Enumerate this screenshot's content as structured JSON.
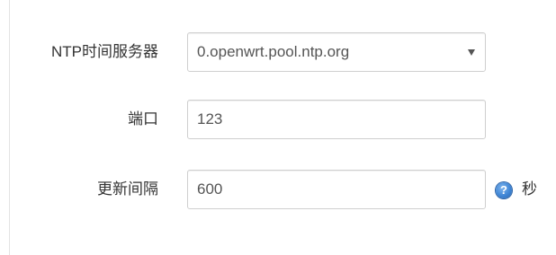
{
  "form": {
    "ntp_server": {
      "label": "NTP时间服务器",
      "value": "0.openwrt.pool.ntp.org"
    },
    "port": {
      "label": "端口",
      "value": "123"
    },
    "update_interval": {
      "label": "更新间隔",
      "value": "600",
      "help_icon": "?",
      "unit": "秒"
    }
  }
}
